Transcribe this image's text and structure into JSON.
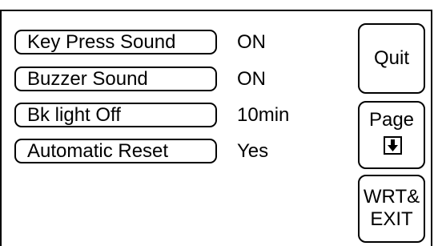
{
  "settings": [
    {
      "label": "Key Press Sound",
      "value": "ON"
    },
    {
      "label": "Buzzer Sound",
      "value": "ON"
    },
    {
      "label": "Bk light Off",
      "value": "10min"
    },
    {
      "label": "Automatic Reset",
      "value": "Yes"
    }
  ],
  "buttons": {
    "quit_label": "Quit",
    "page_label": "Page",
    "page_icon": "arrow-down-icon",
    "wrt_line1": "WRT&",
    "wrt_line2": "EXIT"
  }
}
